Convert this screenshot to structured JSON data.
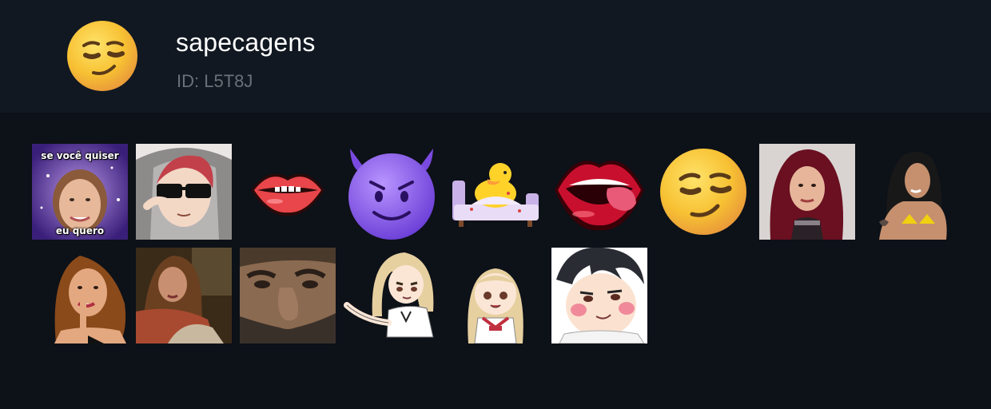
{
  "pack": {
    "title": "sapecagens",
    "id_text": "ID: L5T8J",
    "icon": "smirking-face-icon"
  },
  "colors": {
    "background": "#0d1118",
    "header": "#111821",
    "title": "#ffffff",
    "id": "#6b7078"
  },
  "stickers": [
    {
      "name": "sticker-girl-meme",
      "caption_top": "se você quiser",
      "caption_bottom": "eu quero"
    },
    {
      "name": "sticker-anime-sunglasses"
    },
    {
      "name": "sticker-lips-biting"
    },
    {
      "name": "sticker-purple-devil"
    },
    {
      "name": "sticker-duck-bed"
    },
    {
      "name": "sticker-lips-tongue"
    },
    {
      "name": "sticker-smirking-face"
    },
    {
      "name": "sticker-woman-red-hair"
    },
    {
      "name": "sticker-woman-yellow-bikini"
    },
    {
      "name": "sticker-woman-biting-finger"
    },
    {
      "name": "sticker-woman-bed"
    },
    {
      "name": "sticker-man-closeup"
    },
    {
      "name": "sticker-anime-girl-pointing"
    },
    {
      "name": "sticker-anime-girl-sailor"
    },
    {
      "name": "sticker-anime-boy-blush"
    }
  ]
}
